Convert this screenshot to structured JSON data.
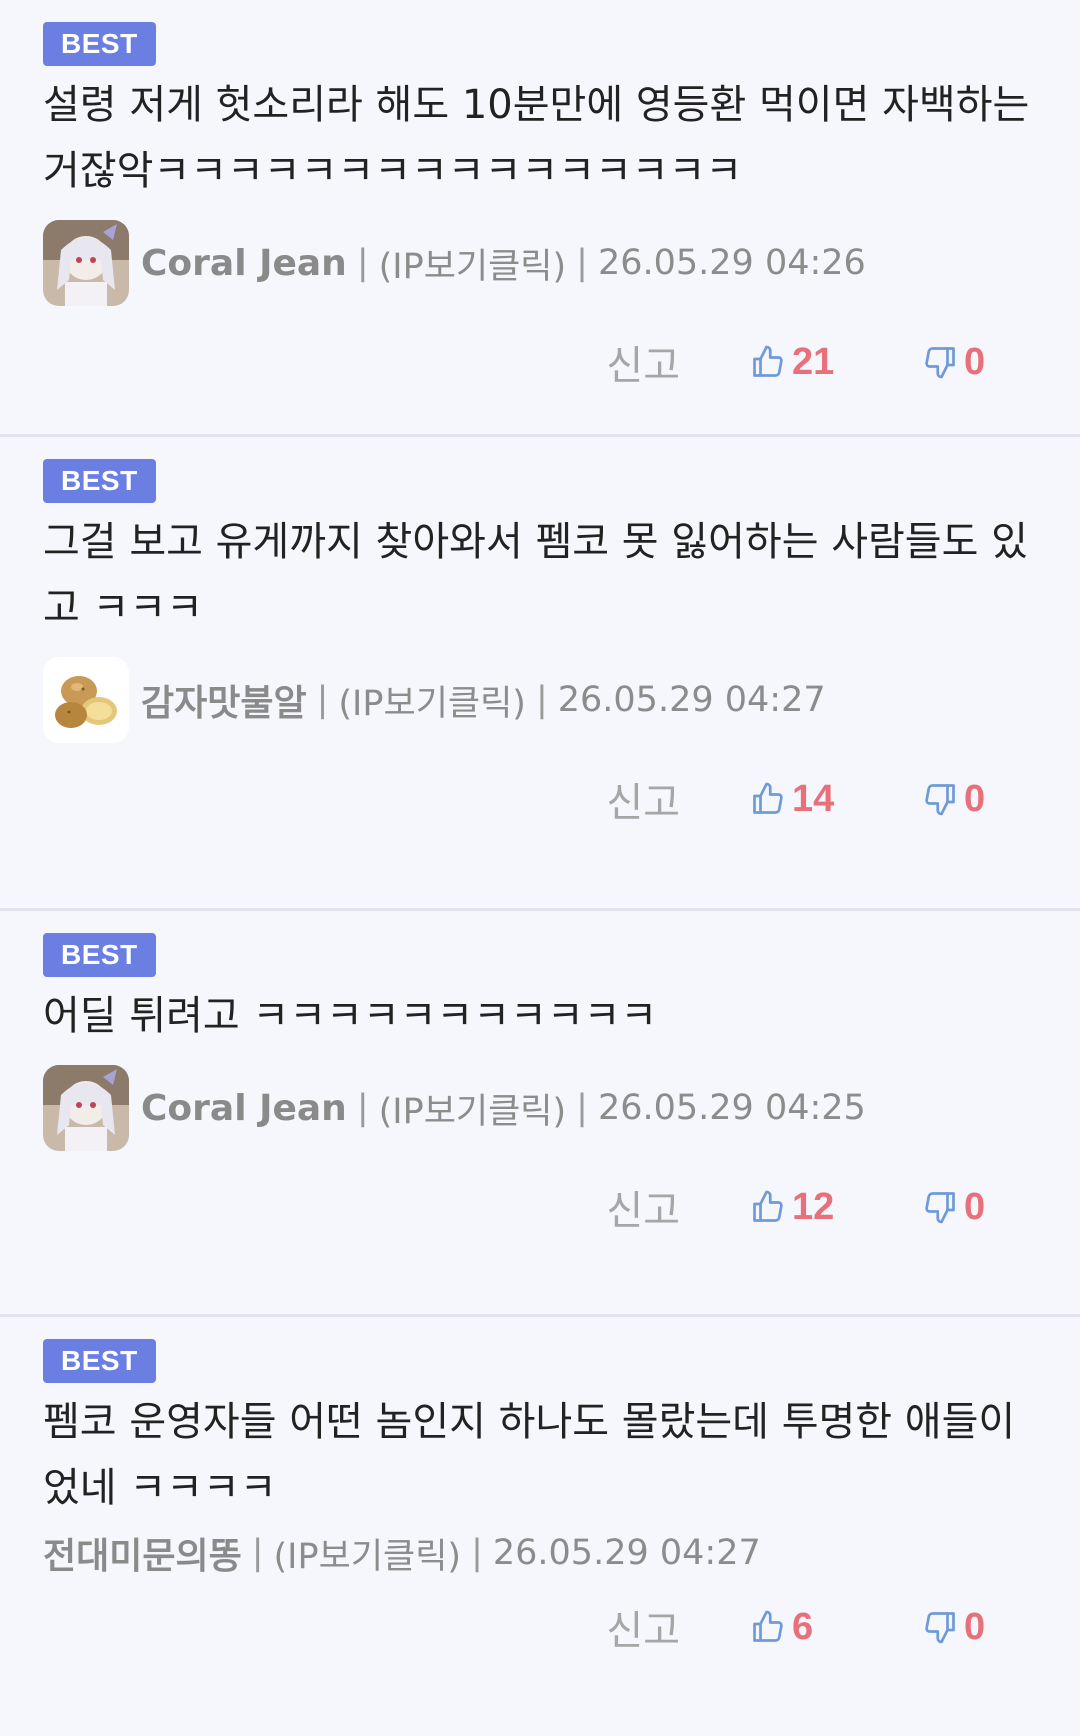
{
  "comments": [
    {
      "badge": "BEST",
      "text": "설령 저게 헛소리라 해도 10분만에 영등환 먹이면 자백하는거잖악ㅋㅋㅋㅋㅋㅋㅋㅋㅋㅋㅋㅋㅋㅋㅋㅋ",
      "nickname": "Coral Jean",
      "ip": "(IP보기클릭)",
      "time": "26.05.29 04:26",
      "report": "신고",
      "likes": "21",
      "dislikes": "0"
    },
    {
      "badge": "BEST",
      "text": "그걸 보고 유게까지 찾아와서 펨코 못 잃어하는 사람들도 있고 ㅋㅋㅋ",
      "nickname": "감자맛불알",
      "ip": "(IP보기클릭)",
      "time": "26.05.29 04:27",
      "report": "신고",
      "likes": "14",
      "dislikes": "0"
    },
    {
      "badge": "BEST",
      "text": "어딜 튀려고 ㅋㅋㅋㅋㅋㅋㅋㅋㅋㅋㅋ",
      "nickname": "Coral Jean",
      "ip": "(IP보기클릭)",
      "time": "26.05.29 04:25",
      "report": "신고",
      "likes": "12",
      "dislikes": "0"
    },
    {
      "badge": "BEST",
      "text": "펨코 운영자들 어떤 놈인지 하나도 몰랐는데 투명한 애들이었네 ㅋㅋㅋㅋ",
      "nickname": "전대미문의똥",
      "ip": "(IP보기클릭)",
      "time": "26.05.29 04:27",
      "report": "신고",
      "likes": "6",
      "dislikes": "0"
    }
  ],
  "colors": {
    "badge": "#6b7fe3",
    "vote_count": "#e8707a",
    "thumb_icon": "#6f9ad8",
    "background": "#f5f7fc"
  },
  "icons": {
    "like": "thumbs-up-icon",
    "dislike": "thumbs-down-icon"
  }
}
